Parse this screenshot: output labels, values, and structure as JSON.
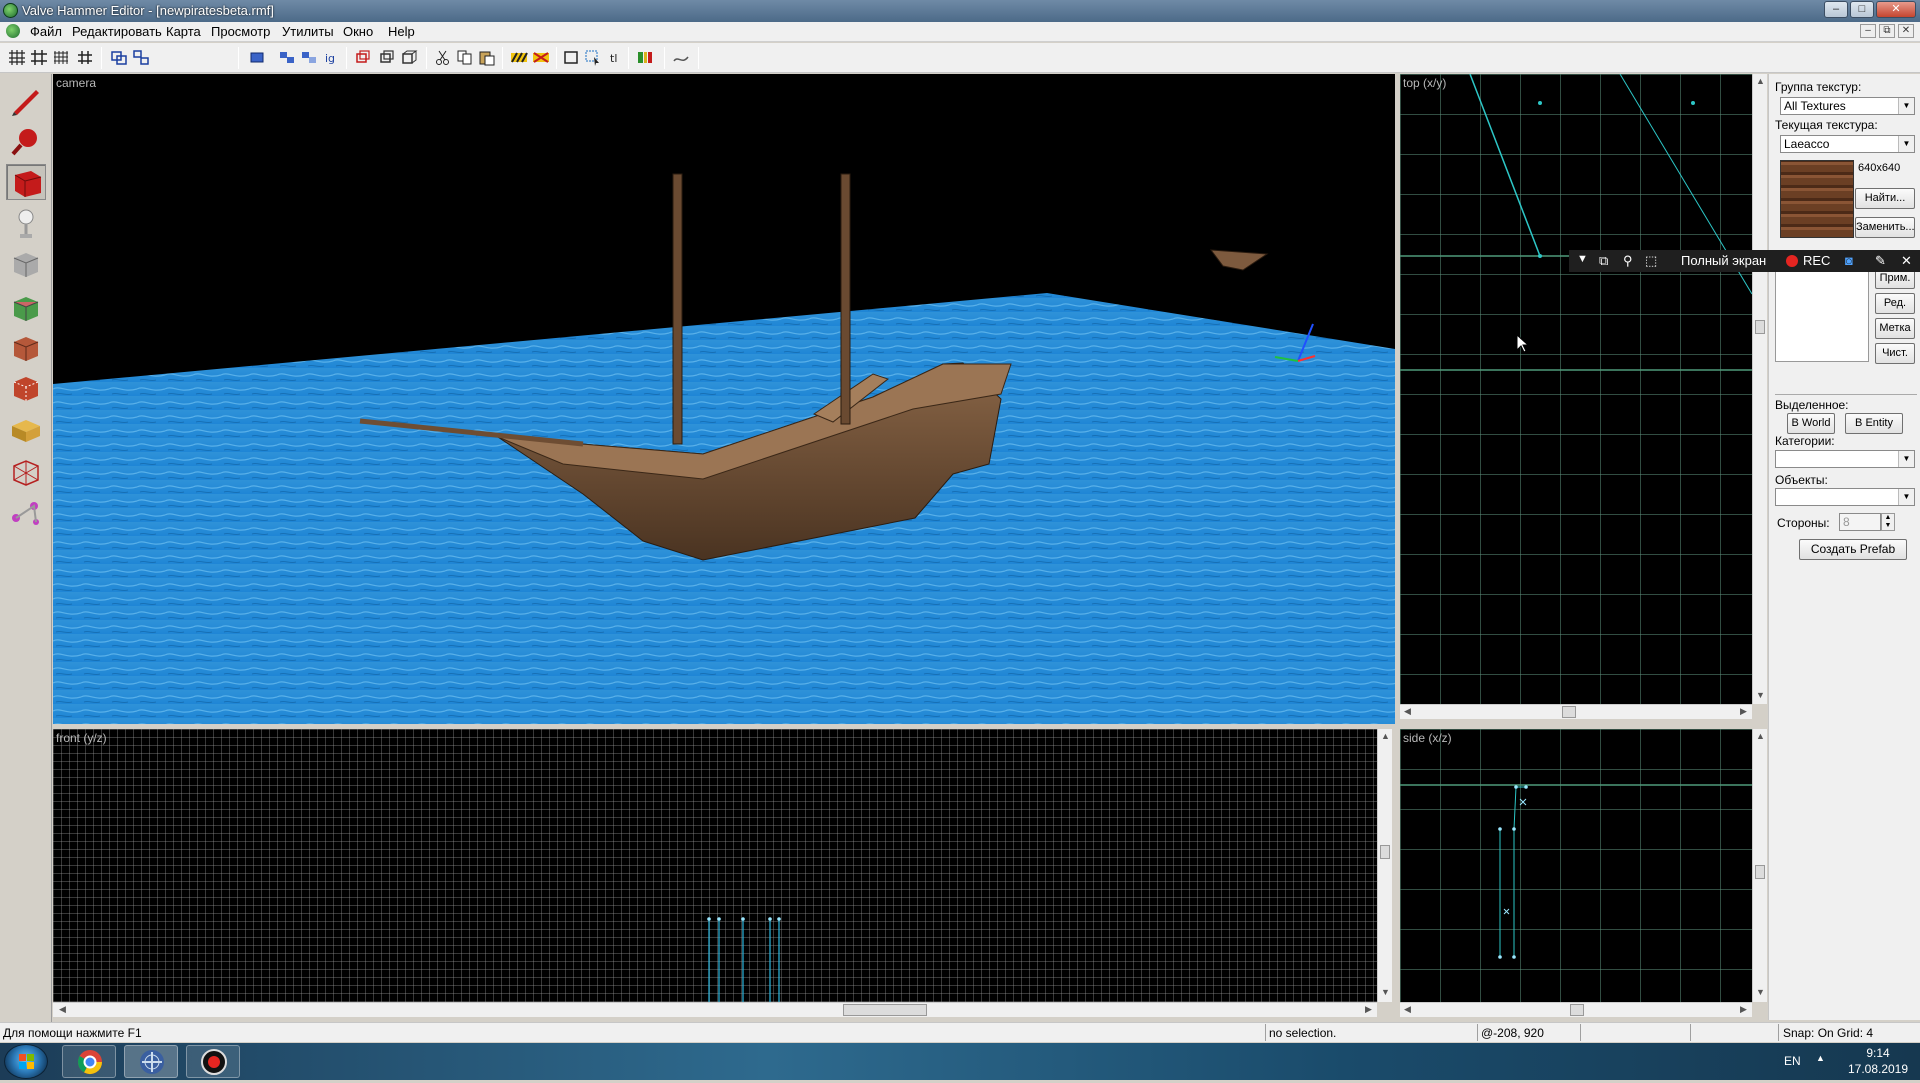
{
  "window": {
    "title": "Valve Hammer Editor - [newpiratesbeta.rmf]",
    "buttons": [
      "–",
      "□",
      "✕"
    ]
  },
  "menu": {
    "items": [
      "Файл",
      "Редактировать",
      "Карта",
      "Просмотр",
      "Утилиты",
      "Окно",
      "Help"
    ]
  },
  "viewports": {
    "camera": {
      "label": "camera"
    },
    "top": {
      "label": "top (x/y)"
    },
    "front": {
      "label": "front (y/z)"
    },
    "side": {
      "label": "side (x/z)"
    }
  },
  "panel": {
    "texture_group_label": "Группа текстур:",
    "texture_group_value": "All Textures",
    "current_texture_label": "Текущая текстура:",
    "current_texture_value": "Laeacco",
    "texture_size": "640x640",
    "find_button": "Найти...",
    "replace_button": "Заменить...",
    "apply_button": "Прим.",
    "edit_button": "Ред.",
    "mark_button": "Метка",
    "clear_button": "Чист.",
    "selected_label": "Выделенное:",
    "to_world_button": "В World",
    "to_entity_button": "В Entity",
    "categories_label": "Категории:",
    "objects_label": "Объекты:",
    "faces_label": "Стороны:",
    "faces_value": "8",
    "create_prefab_button": "Создать Prefab"
  },
  "recorder": {
    "fullscreen_label": "Полный экран",
    "rec_label": "REC"
  },
  "status": {
    "help_text": "Для помощи нажмите F1",
    "selection": "no selection.",
    "coords": "@-208, 920",
    "snap": "Snap: On Grid: 4"
  },
  "taskbar": {
    "language": "EN",
    "time": "9:14",
    "date": "17.08.2019"
  }
}
